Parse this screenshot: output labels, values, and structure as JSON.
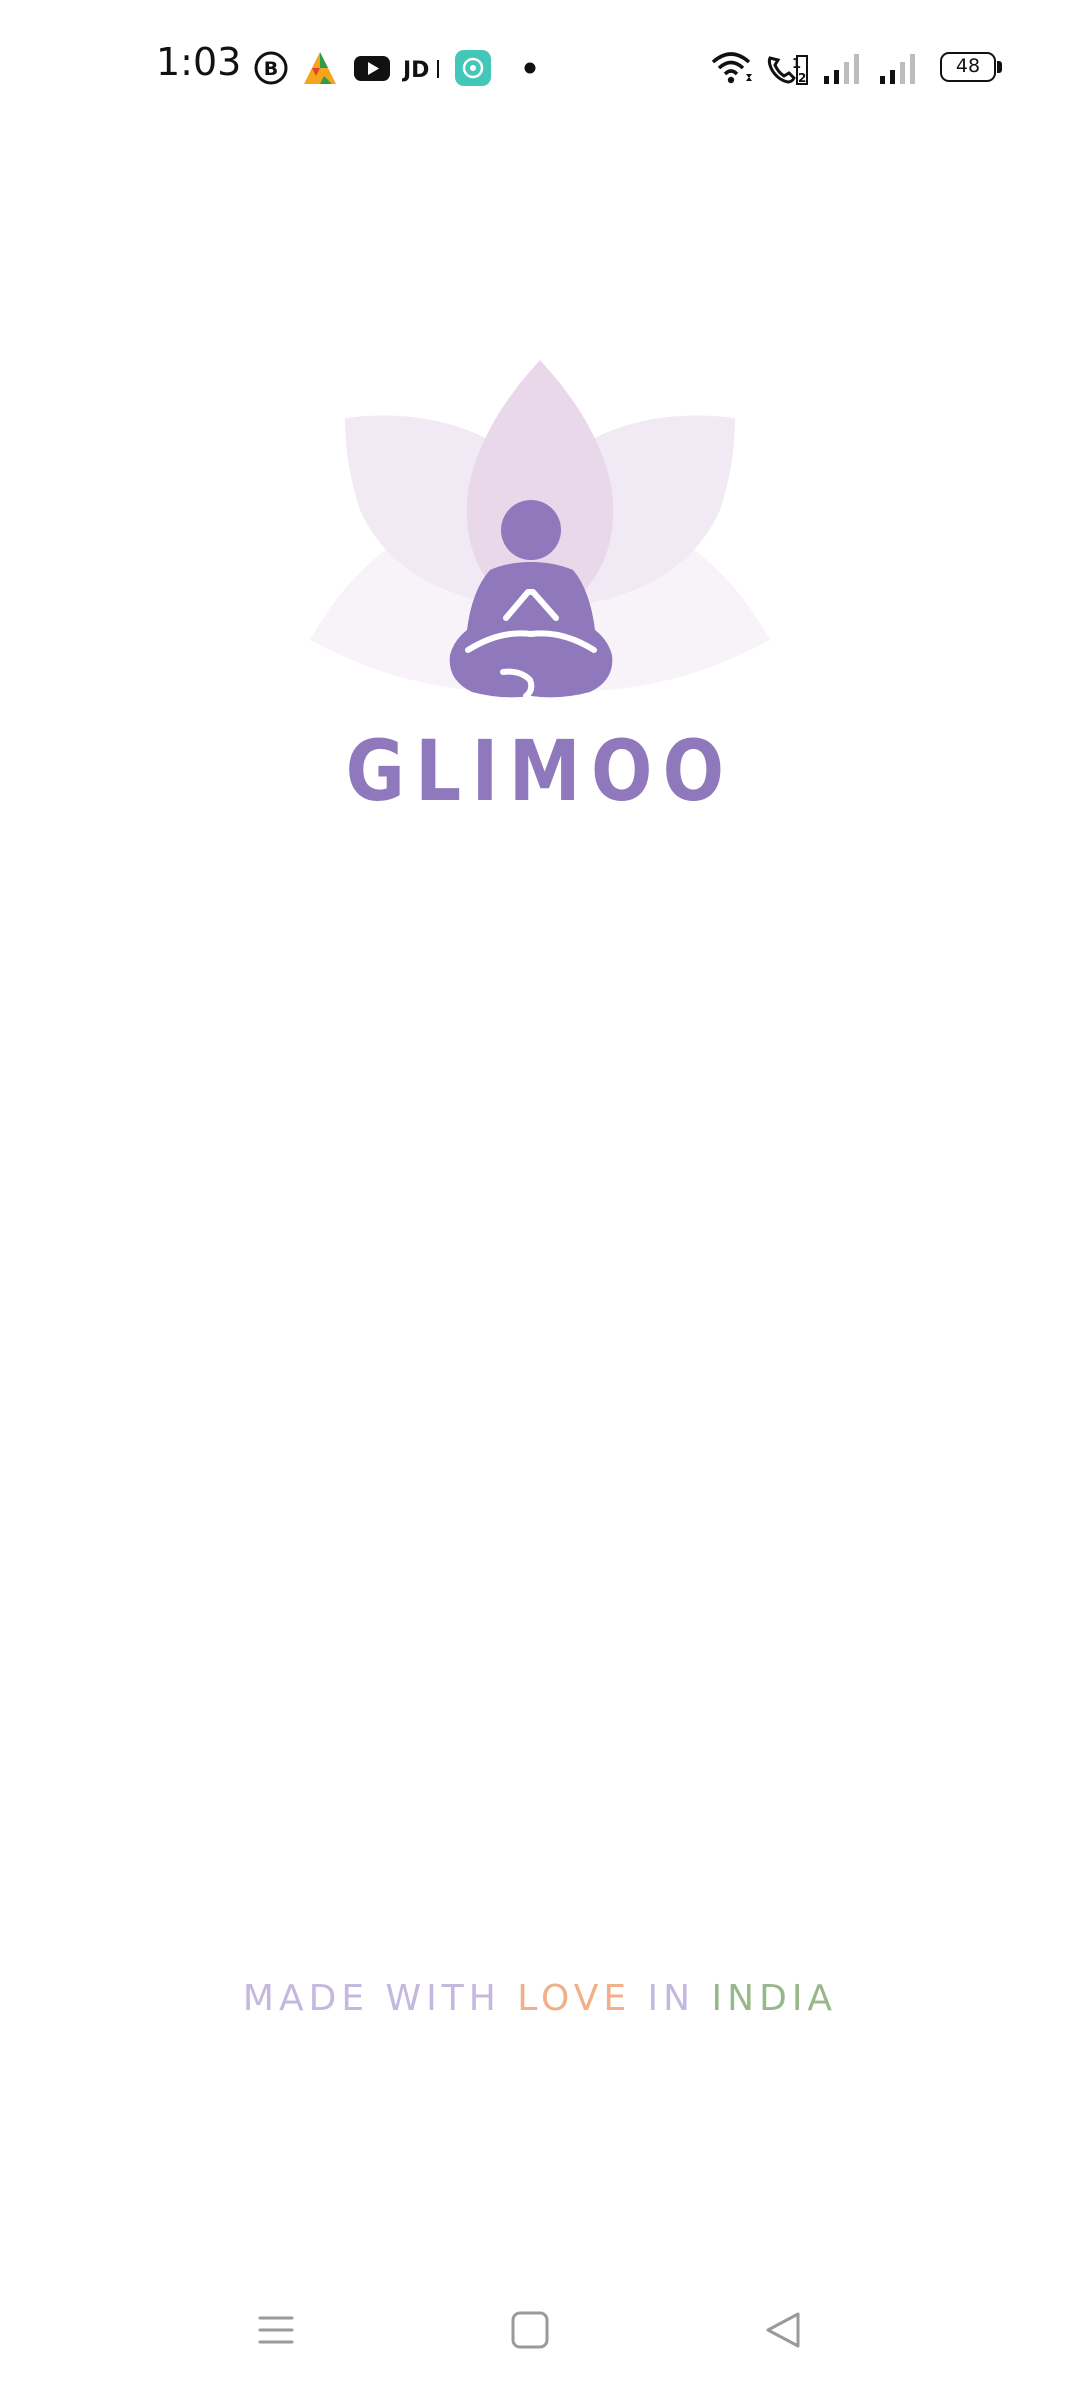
{
  "status_bar": {
    "time": "1:03",
    "notification_icons": [
      "business-icon",
      "app-triangle-icon",
      "youtube-icon",
      "jd-icon",
      "chat-bubble-icon",
      "dot-indicator"
    ],
    "right_icons": [
      "wifi-icon",
      "volte-call-icon",
      "signal-sim1-icon",
      "signal-sim2-icon"
    ],
    "battery_level": "48"
  },
  "splash": {
    "app_name": "GLIMOO",
    "logo_icon": "meditating-figure-lotus-logo",
    "brand_color": "#8f78bb"
  },
  "tagline": {
    "part1": "MADE WITH ",
    "love": "LOVE",
    "part2": " IN ",
    "india": "INDIA",
    "colors": {
      "base": "#c5b8df",
      "love": "#f2b08a",
      "india": "#98b88c"
    }
  },
  "nav_bar": {
    "buttons": [
      "menu-icon",
      "home-icon",
      "back-icon"
    ]
  }
}
